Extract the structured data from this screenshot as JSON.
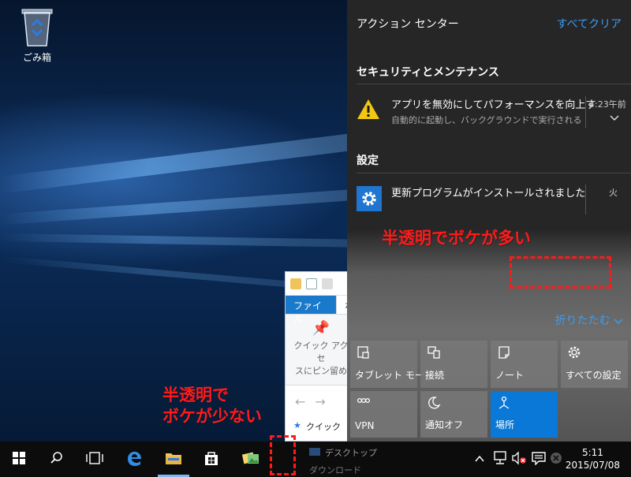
{
  "desktop": {
    "recycle_bin_label": "ごみ箱"
  },
  "explorer": {
    "tab_file": "ファイル",
    "tab_home": "ホ",
    "pin_label_line1": "クイック アクセ",
    "pin_label_line2": "スにピン留め",
    "tree_quick": "クイック",
    "tree_desktop": "デスクトップ",
    "tree_downloads": "ダウンロード"
  },
  "action_center": {
    "title": "アクション センター",
    "clear_all": "すべてクリア",
    "sections": [
      {
        "title": "セキュリティとメンテナンス",
        "notification": {
          "icon": "warning-icon",
          "title": "アプリを無効にしてパフォーマンスを向上す",
          "body": "自動的に起動し、バックグラウンドで実行される",
          "time": "4:23午前"
        }
      },
      {
        "title": "設定",
        "notification": {
          "icon": "gear-icon",
          "title": "更新プログラムがインストールされました",
          "time": "火"
        }
      }
    ],
    "collapse": "折りたたむ",
    "quick_actions": [
      {
        "label": "タブレット モード",
        "icon": "tablet-mode-icon",
        "active": false
      },
      {
        "label": "接続",
        "icon": "connect-icon",
        "active": false
      },
      {
        "label": "ノート",
        "icon": "note-icon",
        "active": false
      },
      {
        "label": "すべての設定",
        "icon": "gear-icon",
        "active": false
      },
      {
        "label": "VPN",
        "icon": "vpn-icon",
        "active": false
      },
      {
        "label": "通知オフ",
        "icon": "moon-icon",
        "active": false
      },
      {
        "label": "場所",
        "icon": "location-icon",
        "active": true
      }
    ]
  },
  "annotations": {
    "high_blur": "半透明でボケが多い",
    "low_blur_line1": "半透明で",
    "low_blur_line2": "ボケが少ない"
  },
  "taskbar": {
    "clock_time": "5:11",
    "clock_date": "2015/07/08"
  },
  "colors": {
    "accent": "#0a78d7",
    "link": "#3b9cf2",
    "annotation": "#ff1a1a"
  }
}
